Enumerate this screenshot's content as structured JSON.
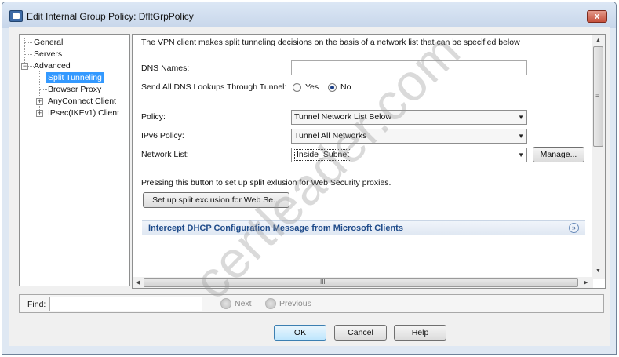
{
  "window": {
    "title": "Edit Internal Group Policy: DfltGrpPolicy",
    "close_label": "x"
  },
  "tree": {
    "items": [
      {
        "label": "General"
      },
      {
        "label": "Servers"
      },
      {
        "label": "Advanced"
      },
      {
        "label": "Split Tunneling"
      },
      {
        "label": "Browser Proxy"
      },
      {
        "label": "AnyConnect Client"
      },
      {
        "label": "IPsec(IKEv1) Client"
      }
    ],
    "selected": "Split Tunneling"
  },
  "panel": {
    "intro": "The VPN client makes split tunneling decisions on the basis of a network list that can be specified below",
    "dns_label": "DNS Names:",
    "dns_value": "",
    "send_all_label": "Send All DNS Lookups Through Tunnel:",
    "yes_label": "Yes",
    "no_label": "No",
    "send_all_selected": "No",
    "policy_label": "Policy:",
    "policy_value": "Tunnel Network List Below",
    "ipv6_label": "IPv6 Policy:",
    "ipv6_value": "Tunnel All Networks",
    "network_list_label": "Network List:",
    "network_list_value": "Inside_Subnet",
    "manage_label": "Manage...",
    "exclusion_text": "Pressing this button to set up split exlusion for Web Security proxies.",
    "exclusion_button": "Set up split exclusion for Web Se...",
    "section_title": "Intercept DHCP Configuration Message from Microsoft Clients",
    "hscroll_grip": "III",
    "vscroll_grip": "≡"
  },
  "find": {
    "label": "Find:",
    "value": "",
    "next": "Next",
    "previous": "Previous"
  },
  "buttons": {
    "ok": "OK",
    "cancel": "Cancel",
    "help": "Help"
  },
  "watermark": "certleader.com"
}
